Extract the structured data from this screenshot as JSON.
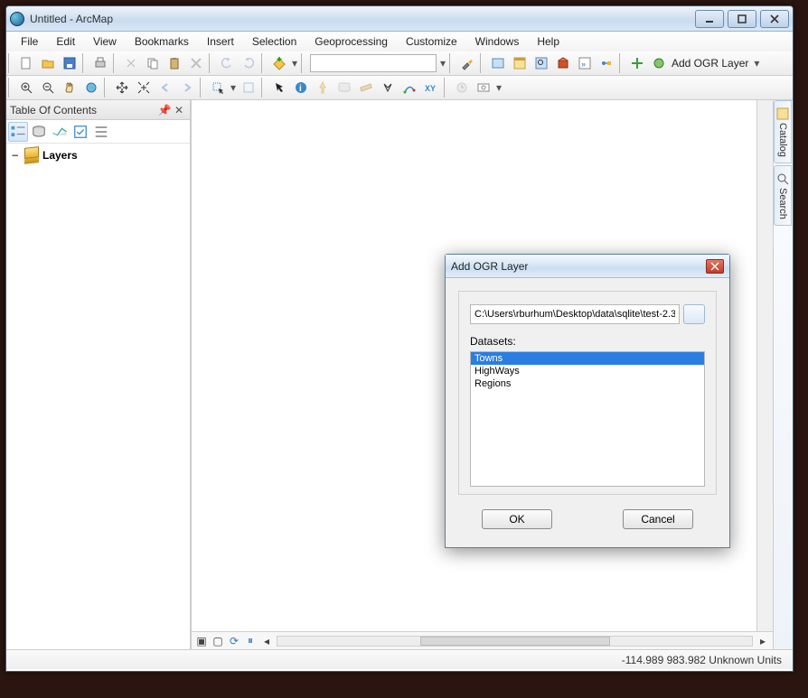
{
  "window": {
    "title": "Untitled - ArcMap"
  },
  "menu": [
    "File",
    "Edit",
    "View",
    "Bookmarks",
    "Insert",
    "Selection",
    "Geoprocessing",
    "Customize",
    "Windows",
    "Help"
  ],
  "toolbar": {
    "add_ogr_label": "Add OGR Layer"
  },
  "toc": {
    "title": "Table Of Contents",
    "root_label": "Layers"
  },
  "side_tabs": [
    "Catalog",
    "Search"
  ],
  "dialog": {
    "title": "Add OGR Layer",
    "path_value": "C:\\Users\\rburhum\\Desktop\\data\\sqlite\\test-2.3.s",
    "datasets_label": "Datasets:",
    "items": [
      "Towns",
      "HighWays",
      "Regions"
    ],
    "selected_index": 0,
    "ok_label": "OK",
    "cancel_label": "Cancel"
  },
  "status": {
    "coords": "-114.989  983.982 Unknown Units"
  }
}
